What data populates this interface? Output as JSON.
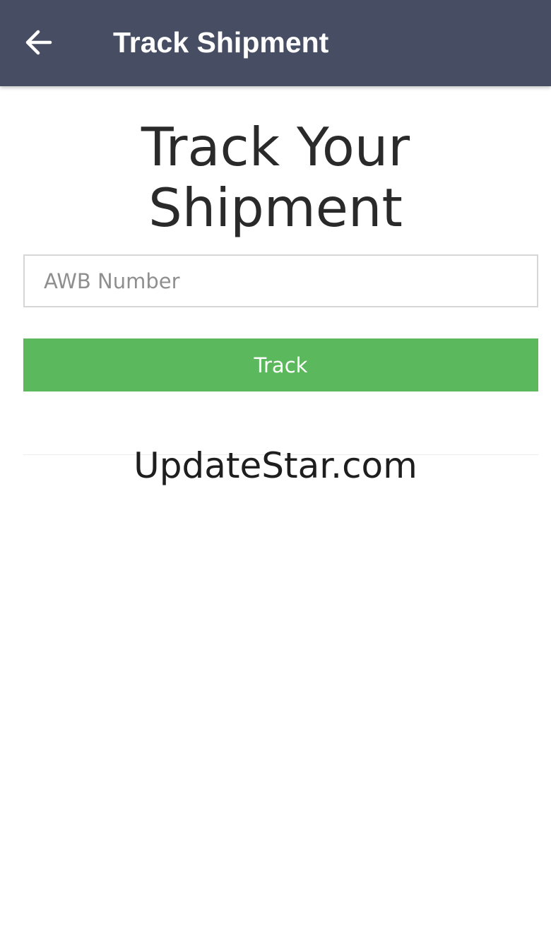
{
  "app_bar": {
    "back_icon": "arrow-left-icon",
    "title": "Track Shipment",
    "background_color": "#474d63"
  },
  "main": {
    "heading_line1": "Track Your",
    "heading_line2": "Shipment",
    "awb_input": {
      "placeholder": "AWB Number",
      "value": ""
    },
    "track_button": {
      "label": "Track",
      "color": "#5cb85c"
    }
  },
  "watermark": {
    "text": "UpdateStar.com"
  }
}
